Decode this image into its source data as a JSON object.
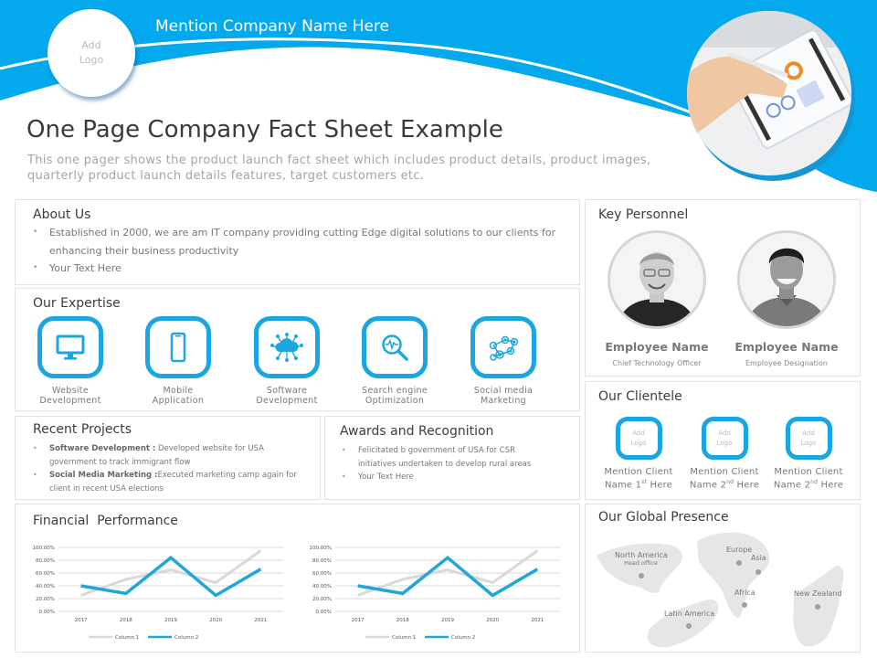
{
  "colors": {
    "accent": "#1aa6e0",
    "header_blue": "#03a9ec",
    "series1": "#d9d9d9",
    "series2": "#21a6d9",
    "map_land": "#e6e6e6",
    "map_dot": "#a0a0a0"
  },
  "header": {
    "logo_placeholder": [
      "Add",
      "Logo"
    ],
    "company_name": "Mention Company Name Here",
    "title": "One Page Company Fact Sheet Example",
    "subtitle_lines": [
      "This one pager shows the product launch fact sheet which includes product details, product images,",
      "quarterly product launch details features, target customers etc."
    ],
    "hero_image": "tablet-analytics-photo"
  },
  "about": {
    "title": "About Us",
    "bullets": [
      "Established in 2000, we are am IT company providing cutting Edge digital solutions to our clients for enhancing their business productivity",
      "Your Text Here"
    ]
  },
  "expertise": {
    "title": "Our Expertise",
    "items": [
      {
        "icon": "monitor-icon",
        "label_lines": [
          "Website",
          "Development"
        ]
      },
      {
        "icon": "smartphone-icon",
        "label_lines": [
          "Mobile",
          "Application"
        ]
      },
      {
        "icon": "cloud-network-icon",
        "label_lines": [
          "Software",
          "Development"
        ]
      },
      {
        "icon": "magnifier-pulse-icon",
        "label_lines": [
          "Search engine",
          "Optimization"
        ]
      },
      {
        "icon": "social-network-icon",
        "label_lines": [
          "Social media",
          "Marketing"
        ]
      }
    ]
  },
  "projects": {
    "title": "Recent Projects",
    "items": [
      {
        "bold": "Software Development :",
        "text": " Developed website for USA government to track immigrant flow"
      },
      {
        "bold": "Social Media Marketing :",
        "text": "Executed marketing camp again for client in recent USA elections"
      }
    ]
  },
  "awards": {
    "title": "Awards and Recognition",
    "bullets": [
      "Felicitated b government of USA for CSR initiatives undertaken to develop rural areas",
      "Your Text Here"
    ]
  },
  "financial": {
    "title": "Financial  Performance"
  },
  "chart_data": [
    {
      "type": "line",
      "title": "",
      "categories": [
        "2017",
        "2018",
        "2019",
        "2020",
        "2021"
      ],
      "series": [
        {
          "name": "Column 1",
          "values": [
            25,
            50,
            65,
            45,
            95
          ]
        },
        {
          "name": "Column 2",
          "values": [
            40,
            28,
            84,
            25,
            66
          ]
        }
      ],
      "yticks": [
        "0.00%",
        "20.00%",
        "40.00%",
        "60.00%",
        "80.00%",
        "100.00%"
      ],
      "ylim": [
        0,
        100
      ],
      "xlabel": "",
      "ylabel": "",
      "grid": true,
      "legend": "bottom"
    },
    {
      "type": "line",
      "title": "",
      "categories": [
        "2017",
        "2018",
        "2019",
        "2020",
        "2021"
      ],
      "series": [
        {
          "name": "Column 1",
          "values": [
            25,
            50,
            65,
            45,
            95
          ]
        },
        {
          "name": "Column 2",
          "values": [
            40,
            28,
            84,
            25,
            66
          ]
        }
      ],
      "yticks": [
        "0.00%",
        "20.00%",
        "40.00%",
        "60.00%",
        "80.00%",
        "100.00%"
      ],
      "ylim": [
        0,
        100
      ],
      "xlabel": "",
      "ylabel": "",
      "grid": true,
      "legend": "bottom"
    }
  ],
  "personnel": {
    "title": "Key Personnel",
    "people": [
      {
        "name": "Employee Name",
        "role": "Chief Technology Officer",
        "photo": "older-man-portrait"
      },
      {
        "name": "Employee Name",
        "role": "Employee Designation",
        "photo": "young-man-portrait"
      }
    ]
  },
  "clientele": {
    "title": "Our Clientele",
    "logo_placeholder": [
      "Add",
      "Logo"
    ],
    "clients": [
      {
        "line1": "Mention Client",
        "pre": "Name 1",
        "sup": "st",
        "post": " Here"
      },
      {
        "line1": "Mention Client",
        "pre": "Name 2",
        "sup": "nd",
        "post": " Here"
      },
      {
        "line1": "Mention Client",
        "pre": "Name 2",
        "sup": "nd",
        "post": " Here"
      }
    ]
  },
  "global": {
    "title": "Our Global Presence",
    "locations": [
      {
        "label": "North America",
        "sub": "Head office"
      },
      {
        "label": "Europe"
      },
      {
        "label": "Asia"
      },
      {
        "label": "Africa"
      },
      {
        "label": "New Zealand"
      },
      {
        "label": "Latin America"
      }
    ]
  }
}
